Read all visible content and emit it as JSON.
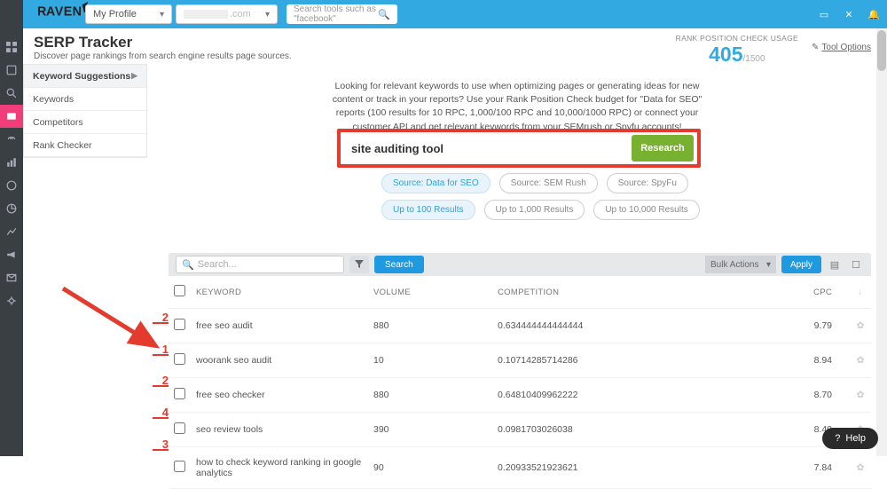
{
  "header": {
    "logo": "RAVEN",
    "profile_select": "My Profile",
    "domain_text": ".com",
    "search_placeholder": "Search tools such as \"facebook\""
  },
  "page": {
    "title": "SERP Tracker",
    "subtitle": "Discover page rankings from search engine results page sources.",
    "usage_label": "RANK POSITION CHECK USAGE",
    "usage_value": "405",
    "usage_limit": "/1500",
    "tool_options": "Tool Options"
  },
  "sidebar": {
    "items": [
      "Keyword Suggestions",
      "Keywords",
      "Competitors",
      "Rank Checker"
    ]
  },
  "intro": "Looking for relevant keywords to use when optimizing pages or generating ideas for new content or track in your reports? Use your Rank Position Check budget for \"Data for SEO\" reports (100 results for 10 RPC, 1,000/100 RPC and 10,000/1000 RPC) or connect your customer API and get relevant keywords from your SEMrush or Spyfu accounts!",
  "research": {
    "input_value": "site auditing tool",
    "button": "Research"
  },
  "sources": [
    "Source: Data for SEO",
    "Source: SEM Rush",
    "Source: SpyFu"
  ],
  "limits": [
    "Up to 100 Results",
    "Up to 1,000 Results",
    "Up to 10,000 Results"
  ],
  "table": {
    "search_placeholder": "Search...",
    "search_button": "Search",
    "bulk_label": "Bulk Actions",
    "apply": "Apply",
    "columns": {
      "keyword": "KEYWORD",
      "volume": "VOLUME",
      "competition": "COMPETITION",
      "cpc": "CPC"
    },
    "rows": [
      {
        "count": "2",
        "keyword": "free seo audit",
        "volume": "880",
        "competition": "0.634444444444444",
        "cpc": "9.79"
      },
      {
        "count": "1",
        "keyword": "woorank seo audit",
        "volume": "10",
        "competition": "0.10714285714286",
        "cpc": "8.94"
      },
      {
        "count": "2",
        "keyword": "free seo checker",
        "volume": "880",
        "competition": "0.64810409962222",
        "cpc": "8.70"
      },
      {
        "count": "4",
        "keyword": "seo review tools",
        "volume": "390",
        "competition": "0.0981703026038",
        "cpc": "8.40"
      },
      {
        "count": "3",
        "keyword": "how to check keyword ranking in google analytics",
        "volume": "90",
        "competition": "0.20933521923621",
        "cpc": "7.84"
      }
    ]
  },
  "help": "Help"
}
